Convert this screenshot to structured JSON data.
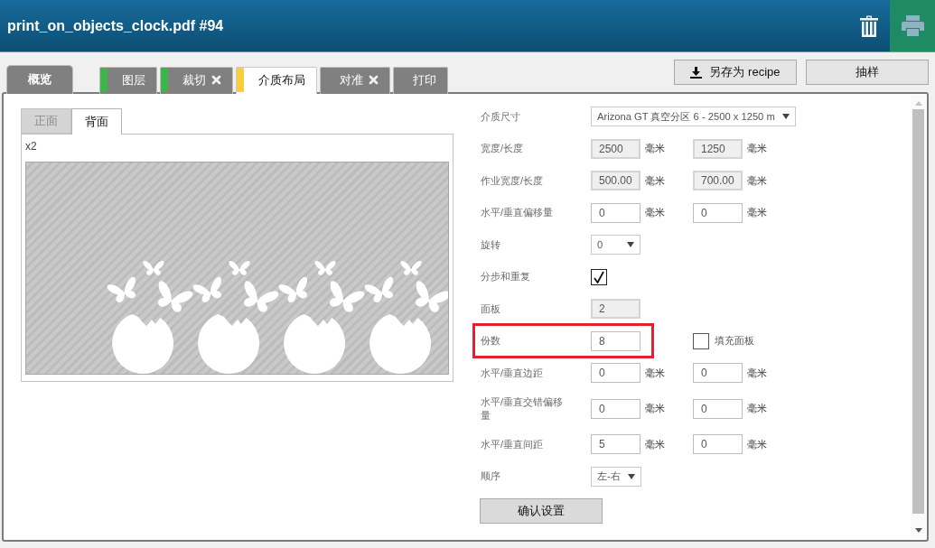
{
  "window": {
    "title": "print_on_objects_clock.pdf #94"
  },
  "tabs": [
    {
      "label": "概览",
      "kind": "overview",
      "selected": false,
      "crossed": false
    },
    {
      "label": "图层",
      "kind": "step",
      "selected": false,
      "crossed": false,
      "color": "#3db54a"
    },
    {
      "label": "裁切",
      "kind": "step",
      "selected": false,
      "crossed": true,
      "color": "#3db54a"
    },
    {
      "label": "介质布局",
      "kind": "step",
      "selected": true,
      "crossed": false,
      "color": "#f8ce3c"
    },
    {
      "label": "对准",
      "kind": "step",
      "selected": false,
      "crossed": true
    },
    {
      "label": "打印",
      "kind": "step",
      "selected": false,
      "crossed": false
    }
  ],
  "actions": [
    {
      "label": "另存为 recipe",
      "kind": "save"
    },
    {
      "label": "抽样",
      "kind": "plain"
    }
  ],
  "side_tabs": [
    {
      "label": "正面",
      "selected": false
    },
    {
      "label": "背面",
      "selected": true
    }
  ],
  "preview": {
    "caption": "x2"
  },
  "form": {
    "rows": [
      {
        "kind": "select",
        "label": "介质尺寸",
        "value": "Arizona GT 真空分区 6 - 2500 x 1250 m",
        "highlighted": false
      },
      {
        "kind": "inputs",
        "label": "宽度/长度",
        "highlighted": false,
        "fields": [
          {
            "value": "2500",
            "unit": "毫米",
            "disabled": true
          },
          {
            "value": "1250",
            "unit": "毫米",
            "disabled": true
          }
        ]
      },
      {
        "kind": "inputs",
        "label": "作业宽度/长度",
        "highlighted": false,
        "fields": [
          {
            "value": "500.00",
            "unit": "毫米",
            "disabled": true
          },
          {
            "value": "700.00",
            "unit": "毫米",
            "disabled": true
          }
        ]
      },
      {
        "kind": "inputs",
        "label": "水平/垂直偏移量",
        "highlighted": false,
        "fields": [
          {
            "value": "0",
            "unit": "毫米",
            "disabled": false
          },
          {
            "value": "0",
            "unit": "毫米",
            "disabled": false
          }
        ]
      },
      {
        "kind": "select",
        "label": "旋转",
        "value": "0",
        "highlighted": false
      },
      {
        "kind": "checkbox",
        "label": "分步和重复",
        "checked": true,
        "highlighted": false
      },
      {
        "kind": "inputs",
        "label": "面板",
        "highlighted": false,
        "fields": [
          {
            "value": "2",
            "disabled": true
          }
        ]
      },
      {
        "kind": "inputs",
        "label": "份数",
        "highlighted": true,
        "fields": [
          {
            "value": "8",
            "disabled": false
          }
        ],
        "option": {
          "label": "填充面板",
          "checked": false
        }
      },
      {
        "kind": "inputs",
        "label": "水平/垂直边距",
        "highlighted": false,
        "fields": [
          {
            "value": "0",
            "unit": "毫米",
            "disabled": false
          },
          {
            "value": "0",
            "unit": "毫米",
            "disabled": false
          }
        ]
      },
      {
        "kind": "inputs",
        "label": "水平/垂直交错偏移量",
        "highlighted": false,
        "fields": [
          {
            "value": "0",
            "unit": "毫米",
            "disabled": false
          },
          {
            "value": "0",
            "unit": "毫米",
            "disabled": false
          }
        ]
      },
      {
        "kind": "inputs",
        "label": "水平/垂直间距",
        "highlighted": false,
        "fields": [
          {
            "value": "5",
            "unit": "毫米",
            "disabled": false
          },
          {
            "value": "0",
            "unit": "毫米",
            "disabled": false
          }
        ]
      },
      {
        "kind": "select",
        "label": "顺序",
        "value": "左-右",
        "highlighted": false
      }
    ],
    "confirm_button": "确认设置"
  }
}
